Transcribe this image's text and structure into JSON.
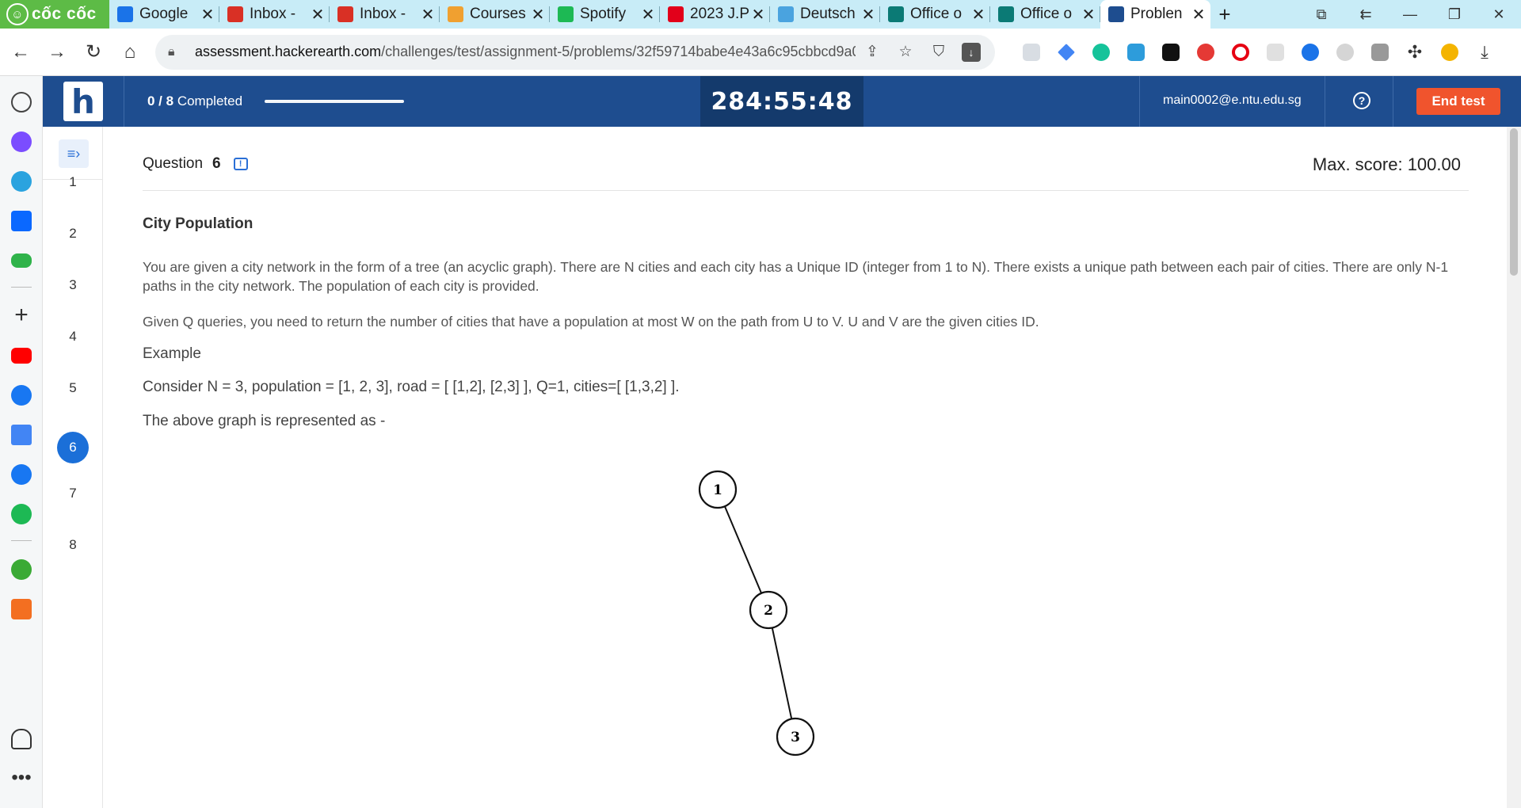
{
  "browser": {
    "brand": "cốc cốc",
    "tabs": [
      {
        "title": "Google",
        "favicon": "calendar-icon",
        "color": "#1a73e8"
      },
      {
        "title": "Inbox -",
        "favicon": "gmail-icon",
        "color": "#d93025"
      },
      {
        "title": "Inbox -",
        "favicon": "gmail-icon",
        "color": "#d93025"
      },
      {
        "title": "Courses",
        "favicon": "pencil-icon",
        "color": "#f0a030"
      },
      {
        "title": "Spotify",
        "favicon": "spotify-icon",
        "color": "#1db954"
      },
      {
        "title": "2023 J.P",
        "favicon": "oracle-icon",
        "color": "#e2001a"
      },
      {
        "title": "Deutsch",
        "favicon": "duolingo-icon",
        "color": "#4aa3df"
      },
      {
        "title": "Office o",
        "favicon": "sharepoint-icon",
        "color": "#0b7a75"
      },
      {
        "title": "Office o",
        "favicon": "sharepoint-icon",
        "color": "#0b7a75"
      },
      {
        "title": "Problen",
        "favicon": "hackerearth-icon",
        "color": "#1e4d8f"
      }
    ],
    "url_domain": "assessment.hackerearth.com",
    "url_path": "/challenges/test/assignment-5/problems/32f59714babe4e43a6c95cbbcd9a04..."
  },
  "header": {
    "logo": "h",
    "completed_count": "0 / 8",
    "completed_label": "Completed",
    "progress_fraction": 0.0,
    "timer": "284:55:48",
    "email": "main0002@e.ntu.edu.sg",
    "help": "?",
    "end_test_label": "End test"
  },
  "rail": {
    "questions": [
      "1",
      "2",
      "3",
      "4",
      "5",
      "6",
      "7",
      "8"
    ],
    "current": "6"
  },
  "question": {
    "label": "Question",
    "number": "6",
    "max_score": "Max. score: 100.00",
    "title": "City Population",
    "paragraphs": [
      "You are given a city network in the form of a tree (an acyclic graph). There are N cities and each city has a Unique ID (integer from 1 to N). There exists a unique path between each pair of cities. There are only N-1 paths in the city network. The population of each city is provided.",
      "Given Q queries, you need to return the number of cities that have a population at most W on the path from U to V. U and V are the given cities ID.",
      "Example",
      "Consider N = 3, population = [1, 2, 3], road = [ [1,2],  [2,3] ], Q=1, cities=[ [1,3,2] ].",
      "The above graph is represented as -"
    ],
    "graph": {
      "nodes": [
        "1",
        "2",
        "3"
      ],
      "edges": [
        [
          "1",
          "2"
        ],
        [
          "2",
          "3"
        ]
      ]
    }
  }
}
